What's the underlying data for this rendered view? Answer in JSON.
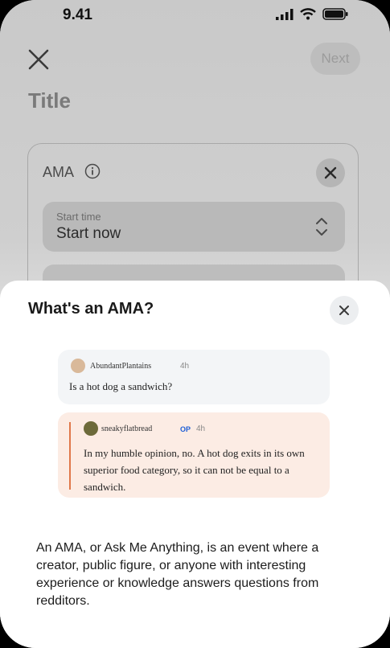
{
  "status_bar": {
    "time": "9.41"
  },
  "header": {
    "close_icon": "close-icon",
    "next_label": "Next"
  },
  "page": {
    "title": "Title"
  },
  "ama_card": {
    "label": "AMA",
    "start_time_label": "Start time",
    "start_time_value": "Start now"
  },
  "sheet": {
    "title": "What's an AMA?",
    "comment": {
      "username": "AbundantPlantains",
      "age": "4h",
      "text": "Is a hot dog a sandwich?"
    },
    "reply": {
      "username": "sneakyflatbread",
      "op_badge": "OP",
      "age": "4h",
      "text": "In my humble opinion, no. A hot dog exits in its own superior food category, so it can not be equal to a sandwich."
    },
    "description": "An AMA, or Ask Me Anything, is an event where a creator, public figure, or anyone with interesting experience or knowledge answers questions from redditors."
  },
  "colors": {
    "reply_accent": "#e0784a",
    "op_badge": "#1f5fd6"
  }
}
